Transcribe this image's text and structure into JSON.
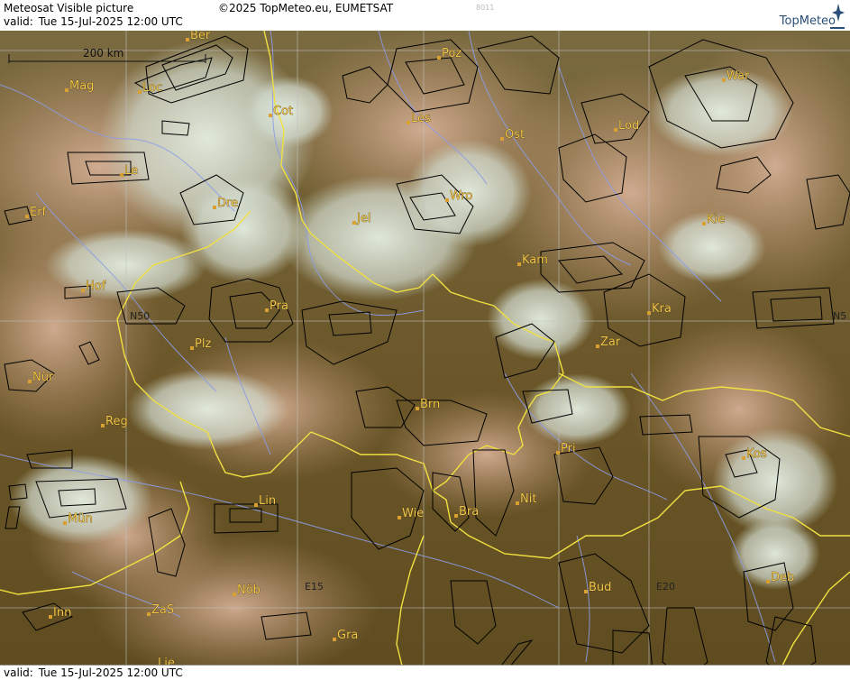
{
  "header": {
    "title": "Meteosat Visible picture",
    "copyright": "©2025 TopMeteo.eu, EUMETSAT",
    "valid_label": "valid:",
    "valid_time": "Tue  15-Jul-2025  12:00 UTC",
    "frame_id": "8011",
    "logo": "TopMeteo"
  },
  "footer": {
    "valid_label": "valid:",
    "valid_time": "Tue  15-Jul-2025  12:00 UTC"
  },
  "scalebar": {
    "label": "200 km"
  },
  "grid_labels": {
    "n50_left": "N50",
    "n50_right": "N5",
    "e15": "E15",
    "e20": "E20"
  },
  "cities": [
    {
      "name": "Ber"
    },
    {
      "name": "Poz"
    },
    {
      "name": "War"
    },
    {
      "name": "Mag"
    },
    {
      "name": "Loc"
    },
    {
      "name": "Cot"
    },
    {
      "name": "Les"
    },
    {
      "name": "Ost"
    },
    {
      "name": "Lod"
    },
    {
      "name": "Le"
    },
    {
      "name": "Dre"
    },
    {
      "name": "Wro"
    },
    {
      "name": "Erf"
    },
    {
      "name": "Jel"
    },
    {
      "name": "Kie"
    },
    {
      "name": "Kam"
    },
    {
      "name": "Hof"
    },
    {
      "name": "Pra"
    },
    {
      "name": "Kra"
    },
    {
      "name": "Plz"
    },
    {
      "name": "Zar"
    },
    {
      "name": "Nür"
    },
    {
      "name": "Brn"
    },
    {
      "name": "Reg"
    },
    {
      "name": "Pri"
    },
    {
      "name": "Kos"
    },
    {
      "name": "Nit"
    },
    {
      "name": "Lin"
    },
    {
      "name": "Wie"
    },
    {
      "name": "Bra"
    },
    {
      "name": "Mün"
    },
    {
      "name": "Nöb"
    },
    {
      "name": "Bud"
    },
    {
      "name": "Deb"
    },
    {
      "name": "Inn"
    },
    {
      "name": "ZaS"
    },
    {
      "name": "Gra"
    },
    {
      "name": "Lie"
    }
  ],
  "colors": {
    "border": "#f0e040",
    "river": "#8c9ce8",
    "grid": "#c0c0c0",
    "city_dot": "#d8a030",
    "city_label": "#f2c84a",
    "terrain": "#6b5a2c",
    "cloud": "#d9e6d8"
  }
}
